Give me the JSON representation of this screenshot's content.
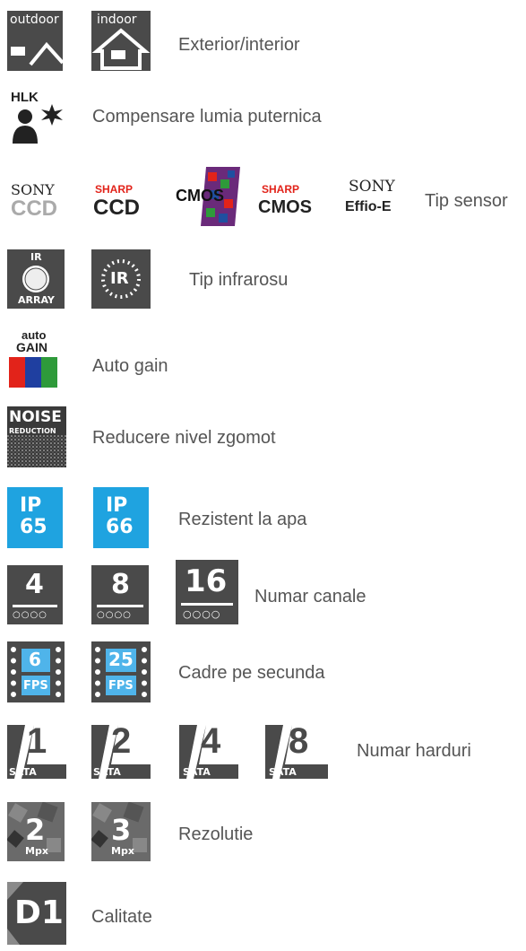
{
  "rows": {
    "exterior": {
      "label": "Exterior/interior",
      "icons": [
        "outdoor",
        "indoor"
      ]
    },
    "hlk": {
      "label": "Compensare lumia puternica",
      "icon_text": "HLK"
    },
    "sensor": {
      "label": "Tip sensor",
      "icons": [
        {
          "brand": "SONY",
          "type": "CCD"
        },
        {
          "brand": "SHARP",
          "type": "CCD"
        },
        {
          "brand": "",
          "type": "CMOS"
        },
        {
          "brand": "SHARP",
          "type": "CMOS"
        },
        {
          "brand": "SONY",
          "type": "Effio-E"
        }
      ]
    },
    "ir": {
      "label": "Tip infrarosu",
      "array_top": "IR",
      "array_bottom": "ARRAY",
      "led": "IR"
    },
    "gain": {
      "label": "Auto gain",
      "top": "auto",
      "bottom": "GAIN"
    },
    "noise": {
      "label": "Reducere nivel zgomot",
      "top": "NOISE",
      "bottom": "REDUCTION"
    },
    "ip": {
      "label": "Rezistent la apa",
      "icons": [
        {
          "top": "IP",
          "bottom": "65"
        },
        {
          "top": "IP",
          "bottom": "66"
        }
      ]
    },
    "channels": {
      "label": "Numar canale",
      "icons": [
        "4",
        "8",
        "16"
      ]
    },
    "fps": {
      "label": "Cadre pe secunda",
      "icons": [
        {
          "num": "6",
          "unit": "FPS"
        },
        {
          "num": "25",
          "unit": "FPS"
        }
      ]
    },
    "hdd": {
      "label": "Numar harduri",
      "icons": [
        "1",
        "2",
        "4",
        "8"
      ],
      "sata": "SATA"
    },
    "resolution": {
      "label": "Rezolutie",
      "icons": [
        {
          "num": "2",
          "unit": "Mpx"
        },
        {
          "num": "3",
          "unit": "Mpx"
        }
      ]
    },
    "quality": {
      "label": "Calitate",
      "icon": "D1"
    }
  },
  "colors": {
    "icon_dark": "#4a4a4a",
    "ip_blue": "#1fa3e0",
    "label_gray": "#555555",
    "sharp_red": "#e2231a"
  }
}
